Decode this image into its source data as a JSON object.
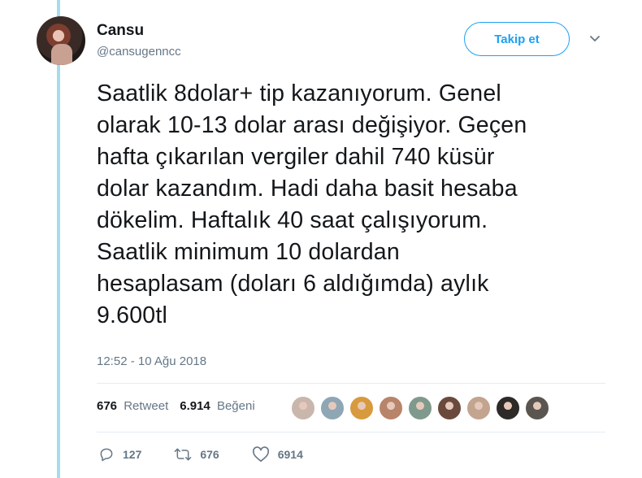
{
  "tweet": {
    "user": {
      "name": "Cansu",
      "handle": "@cansugenncc"
    },
    "follow_label": "Takip et",
    "text": "Saatlik 8dolar+ tip kazanıyorum. Genel\nolarak 10-13 dolar arası değişiyor. Geçen\nhafta çıkarılan vergiler dahil 740 küsür\ndolar kazandım. Hadi daha basit hesaba\ndökelim. Haftalık 40 saat çalışıyorum.\nSaatlik minimum 10 dolardan\nhesaplasam (doları 6 aldığımda) aylık\n9.600tl",
    "timestamp": "12:52 - 10 Ağu 2018",
    "stats": {
      "retweets_count": "676",
      "retweets_label": "Retweet",
      "likes_count": "6.914",
      "likes_label": "Beğeni"
    },
    "liker_avatars": [
      {
        "icon": "avatar-1",
        "color": "#c9b6ad"
      },
      {
        "icon": "avatar-2",
        "color": "#8fa6b5"
      },
      {
        "icon": "avatar-3",
        "color": "#d89a3e"
      },
      {
        "icon": "avatar-4",
        "color": "#b8846a"
      },
      {
        "icon": "avatar-5",
        "color": "#7f9a8c"
      },
      {
        "icon": "avatar-6",
        "color": "#6b4a3e"
      },
      {
        "icon": "avatar-7",
        "color": "#c2a48f"
      },
      {
        "icon": "avatar-8",
        "color": "#2e2a28"
      },
      {
        "icon": "avatar-9",
        "color": "#5b5550"
      }
    ],
    "actions": {
      "replies": "127",
      "retweets": "676",
      "likes": "6914"
    },
    "colors": {
      "accent": "#1da1f2",
      "thread_line": "#a6dcef",
      "muted": "#657786"
    }
  }
}
